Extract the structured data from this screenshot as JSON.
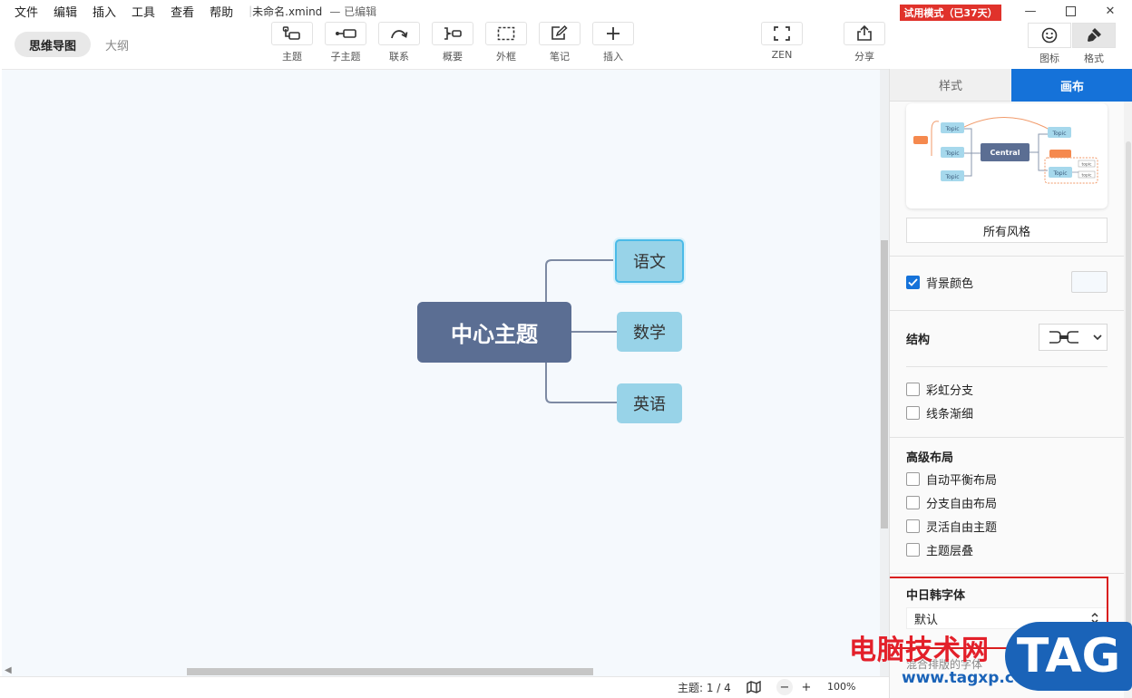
{
  "menu": {
    "items": [
      "文件",
      "编辑",
      "插入",
      "工具",
      "查看",
      "帮助"
    ],
    "doc_title": "未命名.xmind",
    "doc_status": "— 已编辑",
    "trial_badge": "试用模式（已37天）"
  },
  "view_tabs": {
    "mindmap": "思维导图",
    "outline": "大纲"
  },
  "tools": {
    "topic": "主题",
    "subtopic": "子主题",
    "relation": "联系",
    "summary": "概要",
    "boundary": "外框",
    "note": "笔记",
    "insert": "插入",
    "zen": "ZEN",
    "share": "分享",
    "icons": "图标",
    "format": "格式"
  },
  "mindmap": {
    "central": "中心主题",
    "topics": [
      "语文",
      "数学",
      "英语"
    ]
  },
  "statusbar": {
    "topics": "主题: 1 / 4",
    "zoom": "100%"
  },
  "panel": {
    "tab_style": "样式",
    "tab_canvas": "画布",
    "preview": {
      "central": "Central",
      "topic": "Topic",
      "subtopic": "topic"
    },
    "all_styles": "所有风格",
    "bg_color_label": "背景颜色",
    "bg_color_checked": true,
    "bg_color_value": "#f5f9fd",
    "structure_label": "结构",
    "rainbow_branch": "彩虹分支",
    "tapered_lines": "线条渐细",
    "advanced_layout_title": "高级布局",
    "advanced": [
      "自动平衡布局",
      "分支自由布局",
      "灵活自由主题",
      "主题层叠"
    ],
    "cjk_font_title": "中日韩字体",
    "cjk_font_value": "默认",
    "cjk_font_hint": "混合排版的字体"
  },
  "watermark": {
    "text": "电脑技术网",
    "url": "www.tagxp.com",
    "logo": "TAG"
  },
  "colors": {
    "accent": "#1572d9",
    "central": "#5b6e93",
    "topic": "#98d3e8",
    "trial": "#e0322b",
    "highlight": "#d91f1f"
  }
}
